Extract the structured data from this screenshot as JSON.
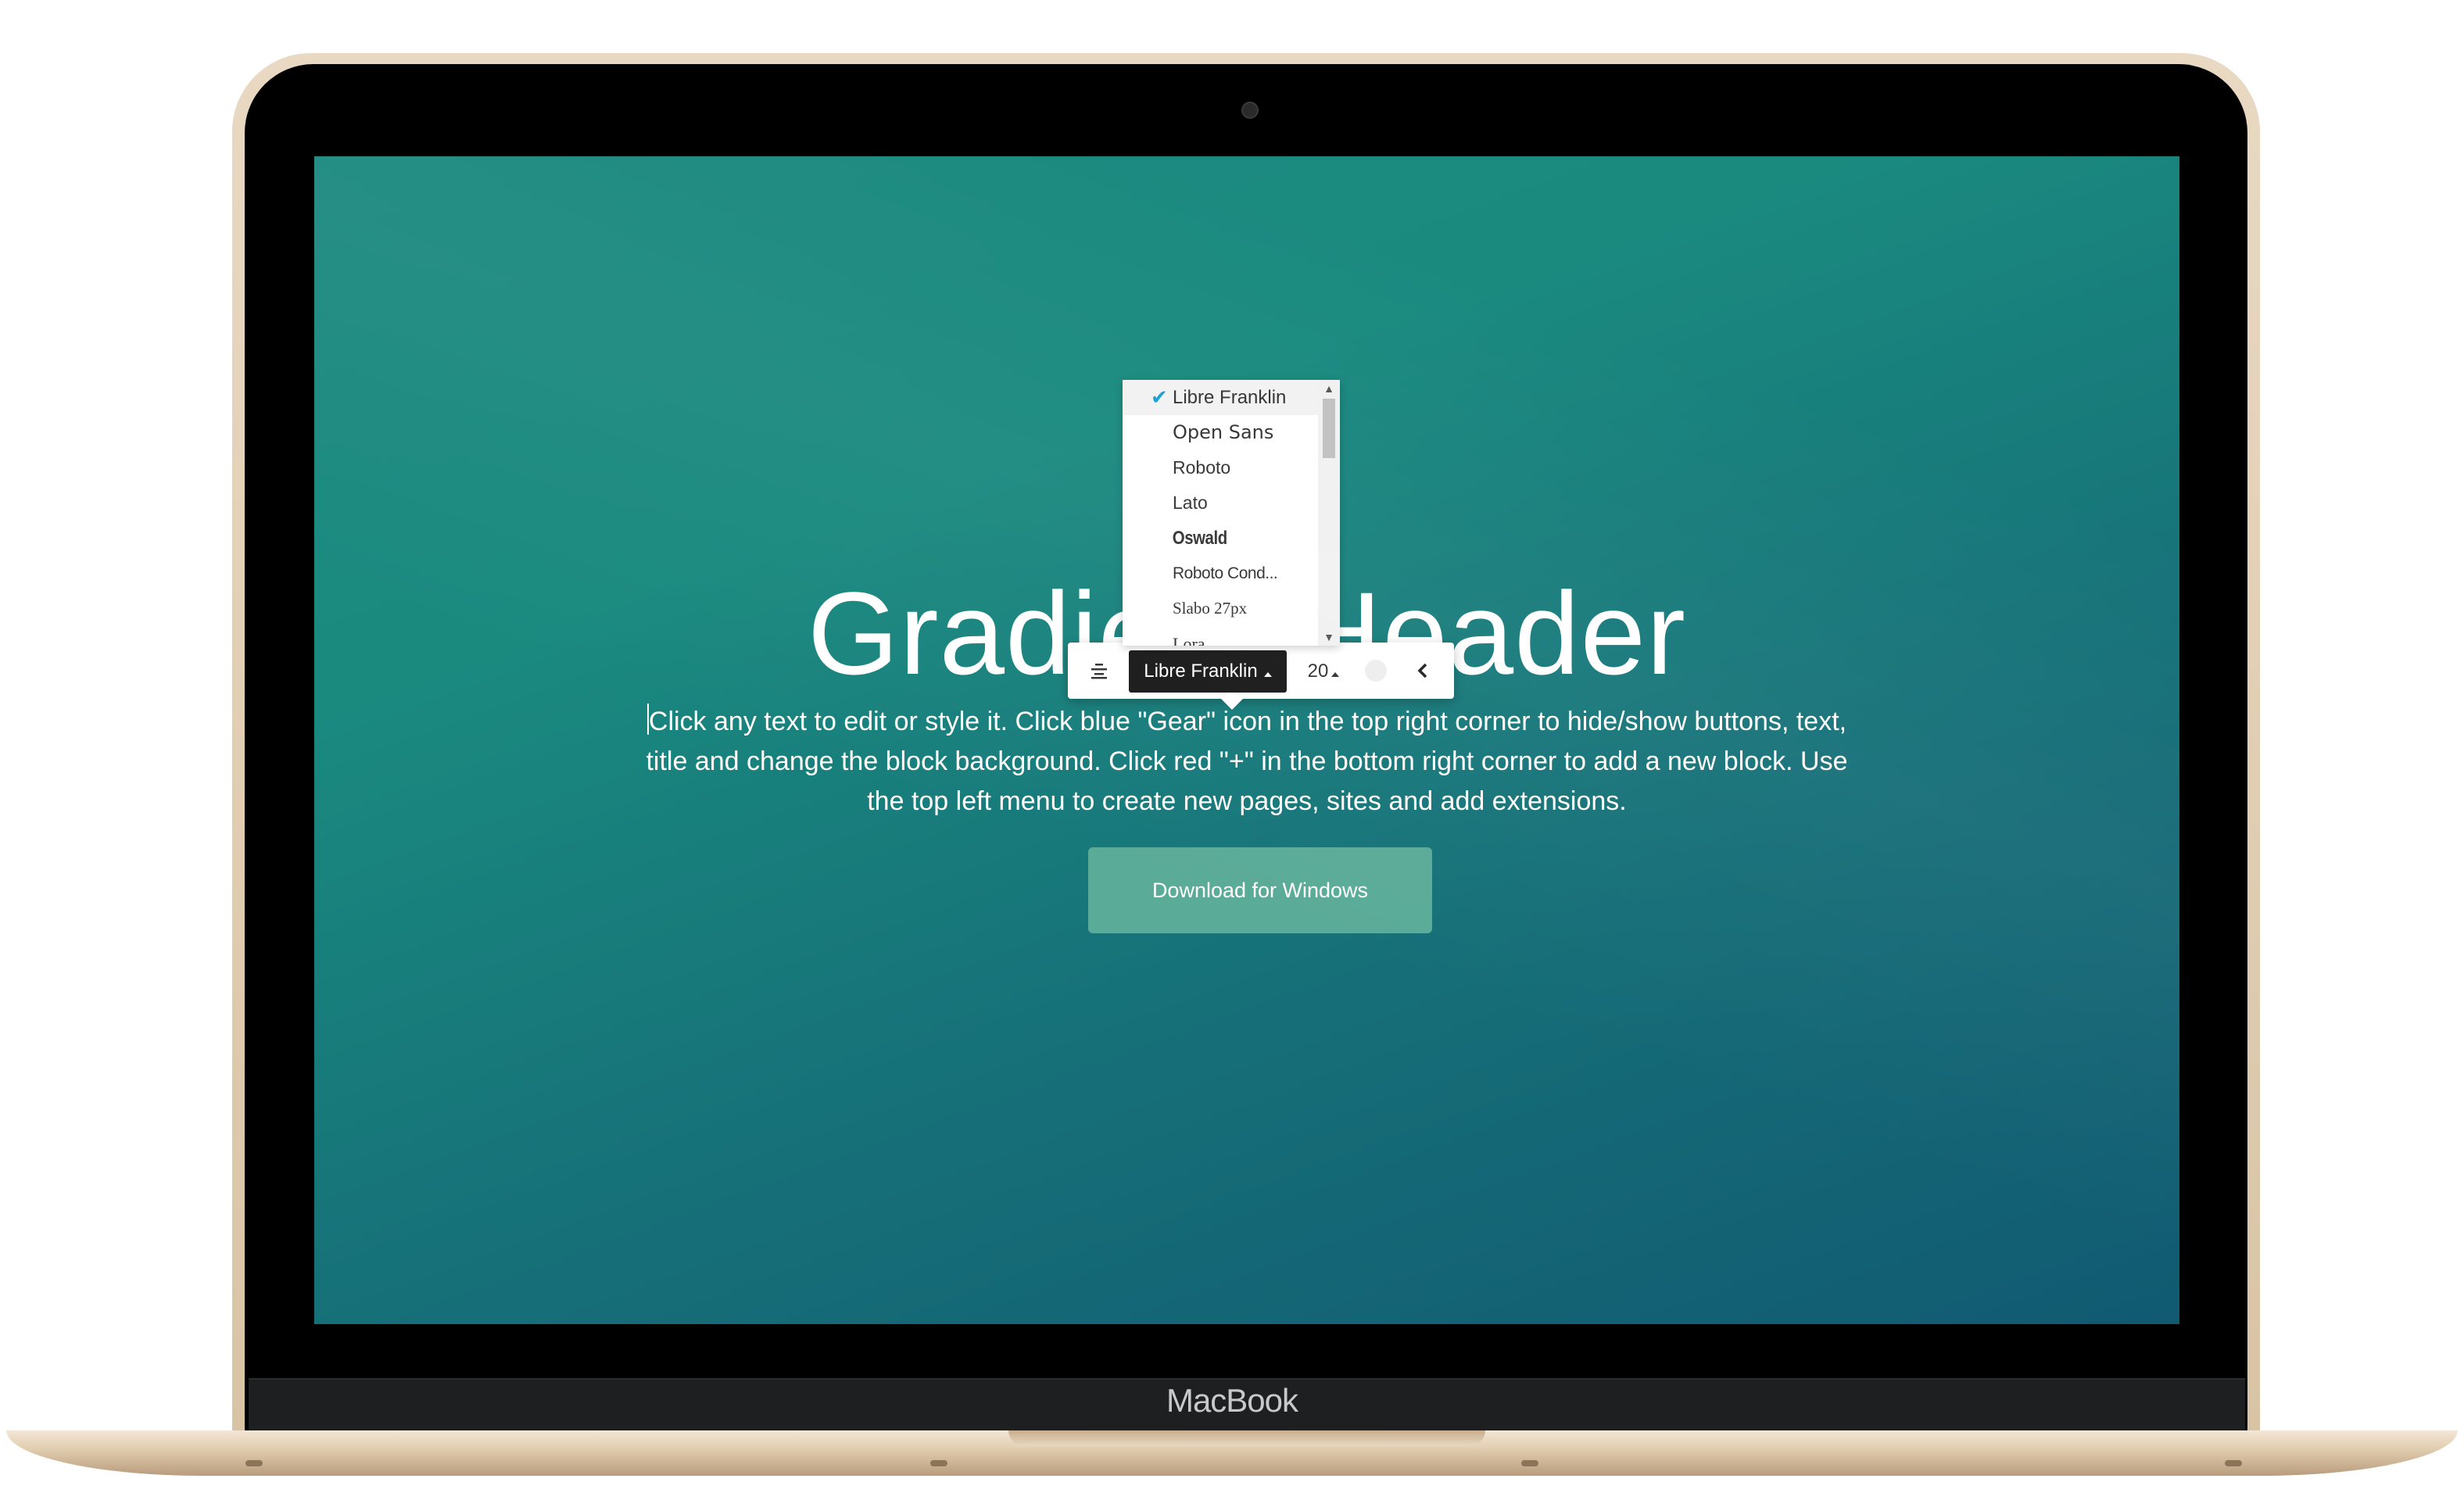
{
  "device": {
    "brand_label": "MacBook"
  },
  "page": {
    "header_title": "Gradient Header",
    "body_text": "Click any text to edit or style it. Click blue \"Gear\" icon in the top right corner to hide/show buttons, text, title and change the block background. Click red \"+\" in the bottom right corner to add a new block. Use the top left menu to create new pages, sites and add extensions.",
    "download_button": "Download for Windows"
  },
  "toolbar": {
    "align_icon": "align-center-icon",
    "font_label": "Libre Franklin",
    "size_label": "20",
    "color_icon": "color-swatch-icon",
    "back_icon": "chevron-left-icon"
  },
  "font_dropdown": {
    "selected": "Libre Franklin",
    "items": [
      {
        "label": "Libre Franklin"
      },
      {
        "label": "Open Sans"
      },
      {
        "label": "Roboto"
      },
      {
        "label": "Lato"
      },
      {
        "label": "Oswald"
      },
      {
        "label": "Roboto Cond..."
      },
      {
        "label": "Slabo 27px"
      },
      {
        "label": "Lora"
      }
    ]
  },
  "colors": {
    "gradient_top": "#1e8a80",
    "gradient_bottom": "#115a72",
    "button_bg": "#5aab98",
    "check_color": "#1a9fd6",
    "toolbar_font_bg": "#1a1a1a"
  }
}
